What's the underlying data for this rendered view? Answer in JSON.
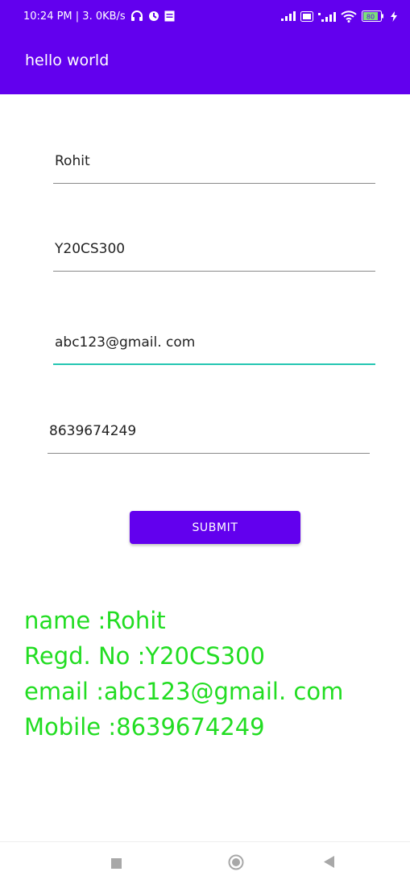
{
  "status_bar": {
    "time_network": "10:24 PM | 3. 0KB/s",
    "battery": "80"
  },
  "app_bar": {
    "title": "hello world"
  },
  "form": {
    "name_value": "Rohit",
    "regno_value": "Y20CS300",
    "email_value": "abc123@gmail. com",
    "mobile_value": "8639674249",
    "submit_label": "SUBMIT"
  },
  "result": {
    "name_line": "name :Rohit",
    "regno_line": "Regd. No :Y20CS300",
    "email_line": "email :abc123@gmail. com",
    "mobile_line": "Mobile :8639674249"
  },
  "colors": {
    "primary": "#6200ee",
    "accent": "#26c6b2",
    "result_text": "#22dd22"
  },
  "nav_bar": {
    "icons": [
      "recents-square-icon",
      "home-circle-icon",
      "back-triangle-icon"
    ]
  }
}
